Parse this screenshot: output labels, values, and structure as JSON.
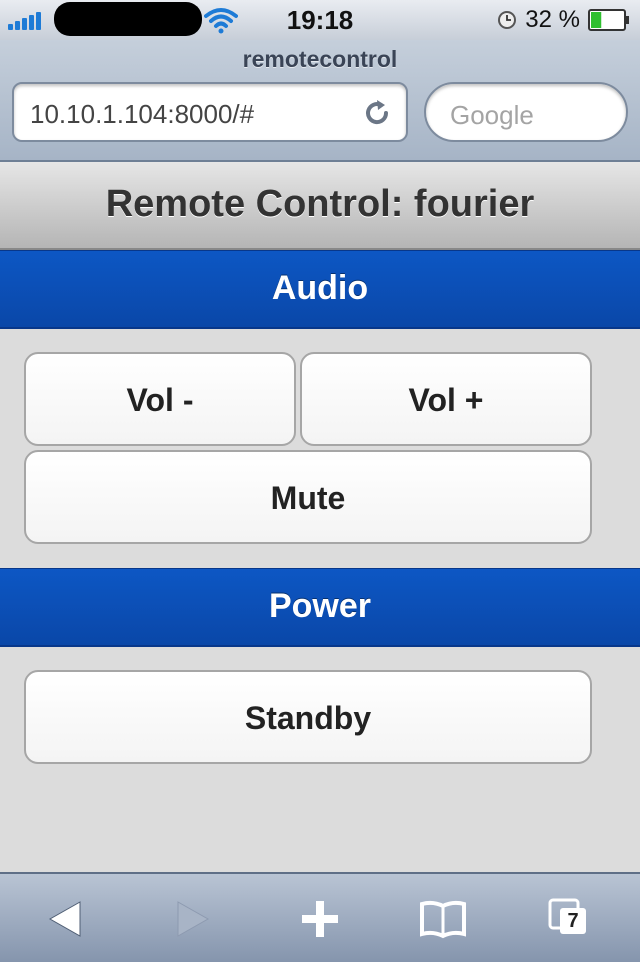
{
  "status_bar": {
    "time": "19:18",
    "battery_percent": "32 %",
    "battery_level": 0.32,
    "signal_icon": "signal-bars-icon",
    "wifi_icon": "wifi-icon",
    "clock_icon": "lock-clock-icon"
  },
  "browser": {
    "page_host": "remotecontrol",
    "url": "10.10.1.104:8000/#",
    "search_placeholder": "Google",
    "tabs_count": "7"
  },
  "page": {
    "title": "Remote Control: fourier",
    "sections": [
      {
        "title": "Audio",
        "buttons": [
          "Vol -",
          "Vol +",
          "Mute"
        ]
      },
      {
        "title": "Power",
        "buttons": [
          "Standby"
        ]
      }
    ]
  },
  "colors": {
    "section_blue": "#0b4fb8",
    "page_background": "#dcdcdc",
    "signal_blue": "#1e7bd6",
    "battery_green": "#2fbf2f"
  }
}
